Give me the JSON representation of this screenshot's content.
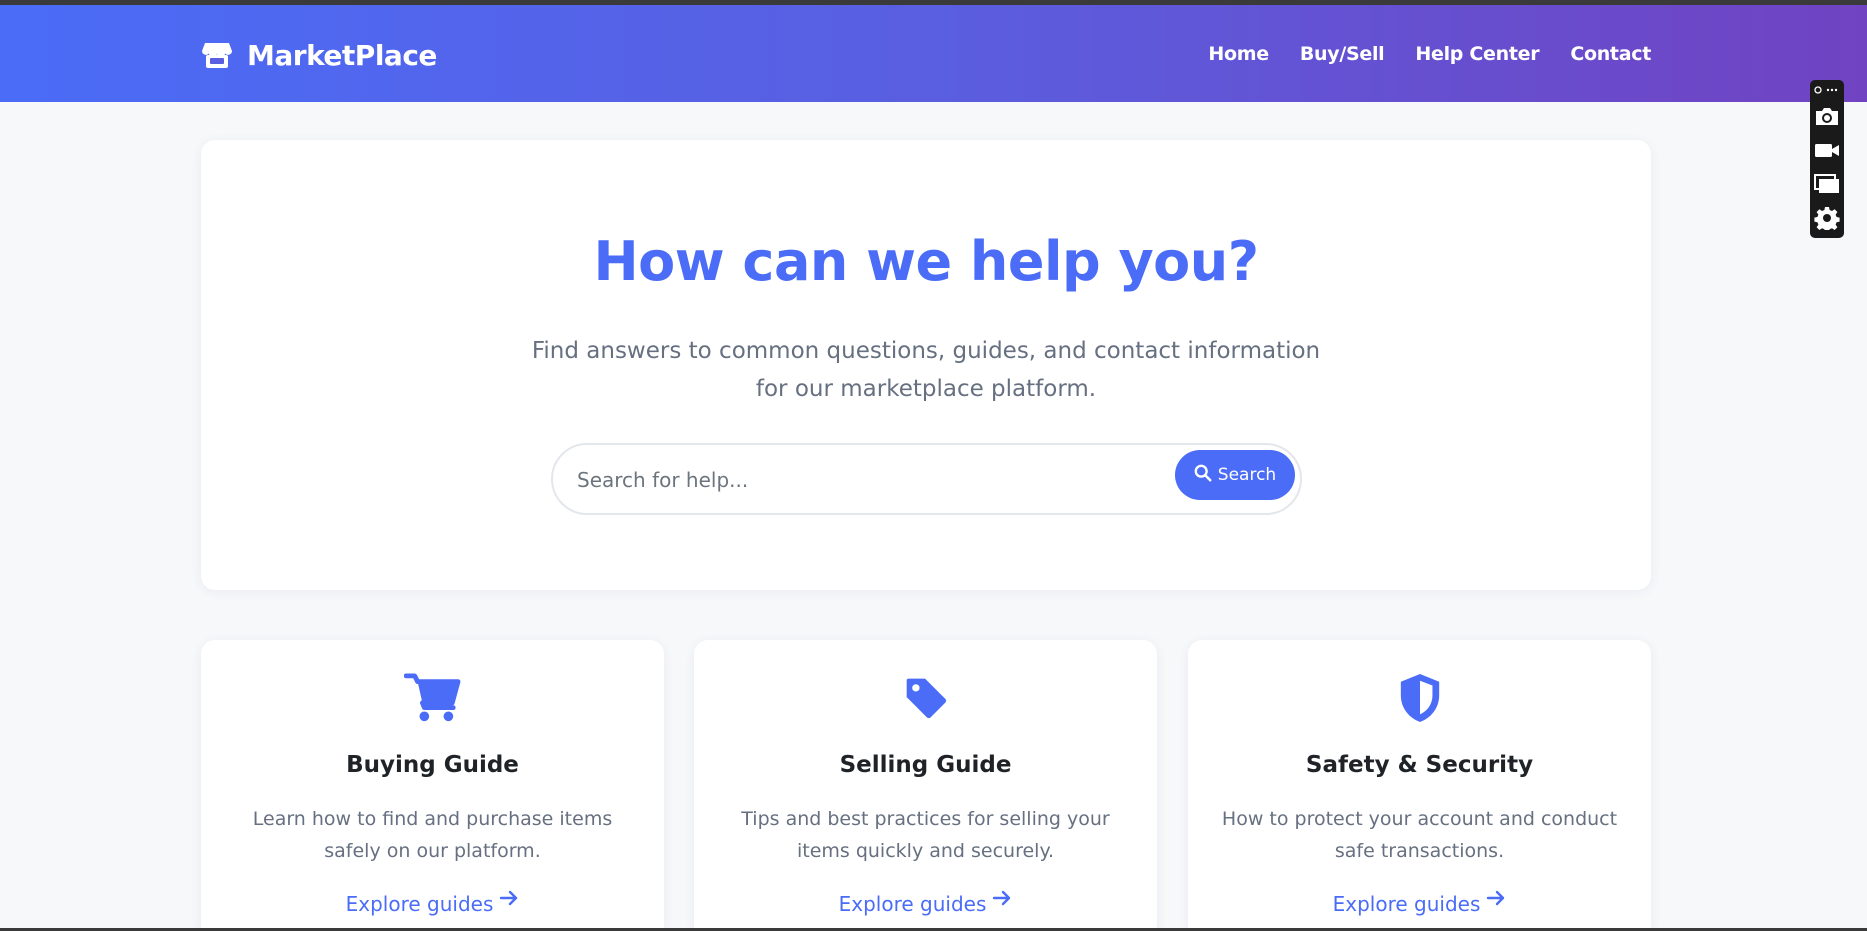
{
  "brand": {
    "name": "MarketPlace",
    "icon": "store-icon"
  },
  "nav": {
    "items": [
      {
        "label": "Home"
      },
      {
        "label": "Buy/Sell"
      },
      {
        "label": "Help Center"
      },
      {
        "label": "Contact"
      }
    ]
  },
  "hero": {
    "title": "How can we help you?",
    "subtitle": "Find answers to common questions, guides, and contact information for our marketplace platform.",
    "search_placeholder": "Search for help...",
    "search_button_label": "Search"
  },
  "cards": [
    {
      "icon": "shopping-cart-icon",
      "title": "Buying Guide",
      "description": "Learn how to find and purchase items safely on our platform.",
      "link_label": "Explore guides"
    },
    {
      "icon": "tag-icon",
      "title": "Selling Guide",
      "description": "Tips and best practices for selling your items quickly and securely.",
      "link_label": "Explore guides"
    },
    {
      "icon": "shield-icon",
      "title": "Safety & Security",
      "description": "How to protect your account and conduct safe transactions.",
      "link_label": "Explore guides"
    }
  ],
  "side_toolbar": {
    "buttons": [
      "camera-icon",
      "video-camera-icon",
      "windows-icon",
      "gear-icon"
    ]
  },
  "colors": {
    "accent": "#4a6cf7",
    "header_gradient_start": "#4a6cf7",
    "header_gradient_end": "#7043c2",
    "text_muted": "#667080",
    "page_background": "#f7f8fa"
  }
}
